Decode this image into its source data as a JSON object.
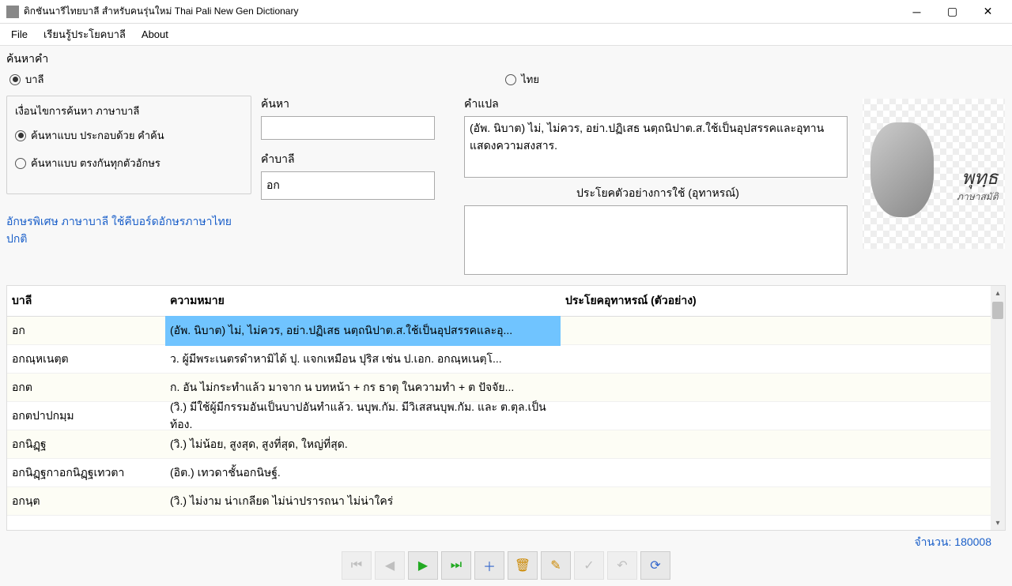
{
  "window": {
    "title": "ดิกชันนารีไทยบาลี สำหรับคนรุ่นใหม่ Thai Pali New Gen Dictionary"
  },
  "menu": {
    "file": "File",
    "learn": "เรียนรู้ประโยคบาลี",
    "about": "About"
  },
  "searchHeader": "ค้นหาคำ",
  "langRadio": {
    "pali": "บาลี",
    "thai": "ไทย"
  },
  "conditions": {
    "header": "เงื่อนไขการค้นหา ภาษาบาลี",
    "contains": "ค้นหาแบบ ประกอบด้วย คำค้น",
    "exact": "ค้นหาแบบ ตรงกันทุกตัวอักษร"
  },
  "specialLink": "อักษรพิเศษ ภาษาบาลี ใช้คีบอร์ดอักษรภาษาไทยปกติ",
  "inputs": {
    "searchLabel": "ค้นหา",
    "paliLabel": "คำบาลี",
    "paliValue": "อก",
    "translationLabel": "คำแปล",
    "translationValue": "(อัพ. นิบาต) ไม่, ไม่ควร, อย่า.ปฏิเสธ นตฺถนิปาต.ส.ใช้เป็นอุปสรรคและอุทานแสดงความสงสาร.",
    "exampleLabel": "ประโยคตัวอย่างการใช้ (อุทาหรณ์)"
  },
  "buddha": {
    "main": "พุทฺธ",
    "sub": "ภาษาสมัติ"
  },
  "grid": {
    "headers": {
      "pali": "บาลี",
      "meaning": "ความหมาย",
      "example": "ประโยคอุทาหรณ์ (ตัวอย่าง)"
    },
    "rows": [
      {
        "pali": "อก",
        "meaning": "(อัพ. นิบาต) ไม่, ไม่ควร, อย่า.ปฏิเสธ นตฺถนิปาต.ส.ใช้เป็นอุปสรรคและอุ...",
        "example": "",
        "selected": true
      },
      {
        "pali": "อกณฺหเนตฺต",
        "meaning": "ว. ผู้มีพระเนตรดำหามิได้ ปุ. แจกเหมือน ปุริส เช่น ป.เอก. อกณฺหเนตฺโ...",
        "example": ""
      },
      {
        "pali": "อกต",
        "meaning": "ก. อัน  ไม่กระทำแล้ว มาจาก น บทหน้า + กร ธาตุ ในความทำ + ต ปัจจัย...",
        "example": ""
      },
      {
        "pali": "อกตปาปกมฺม",
        "meaning": "(วิ.) มีใช้ผู้มีกรรมอันเป็นบาปอันทำแล้ว. นบุพ.กัม. มีวิเสสนบุพ.กัม. และ ต.ตุล.เป็นท้อง.",
        "example": ""
      },
      {
        "pali": "อกนิฏฺฐ",
        "meaning": "(วิ.) ไม่น้อย, สูงสุด, สูงที่สุด, ใหญ่ที่สุด.",
        "example": ""
      },
      {
        "pali": "อกนิฏฺฐกาอกนิฏฺฐเทวตา",
        "meaning": "(อิต.) เทวดาชั้นอกนิษฐ์.",
        "example": ""
      },
      {
        "pali": "อกนฺต",
        "meaning": "(วิ.) ไม่งาม  น่าเกลียด  ไม่น่าปรารถนา  ไม่น่าใคร่",
        "example": ""
      }
    ]
  },
  "countLabel": "จำนวน: 180008",
  "nav": {
    "first": "⇤",
    "prev": "⇦",
    "next": "⇨",
    "last": "⇥",
    "add": "＋",
    "delete": "🗑",
    "edit": "✎",
    "confirm": "✓",
    "undo": "↶",
    "refresh": "⟳"
  }
}
